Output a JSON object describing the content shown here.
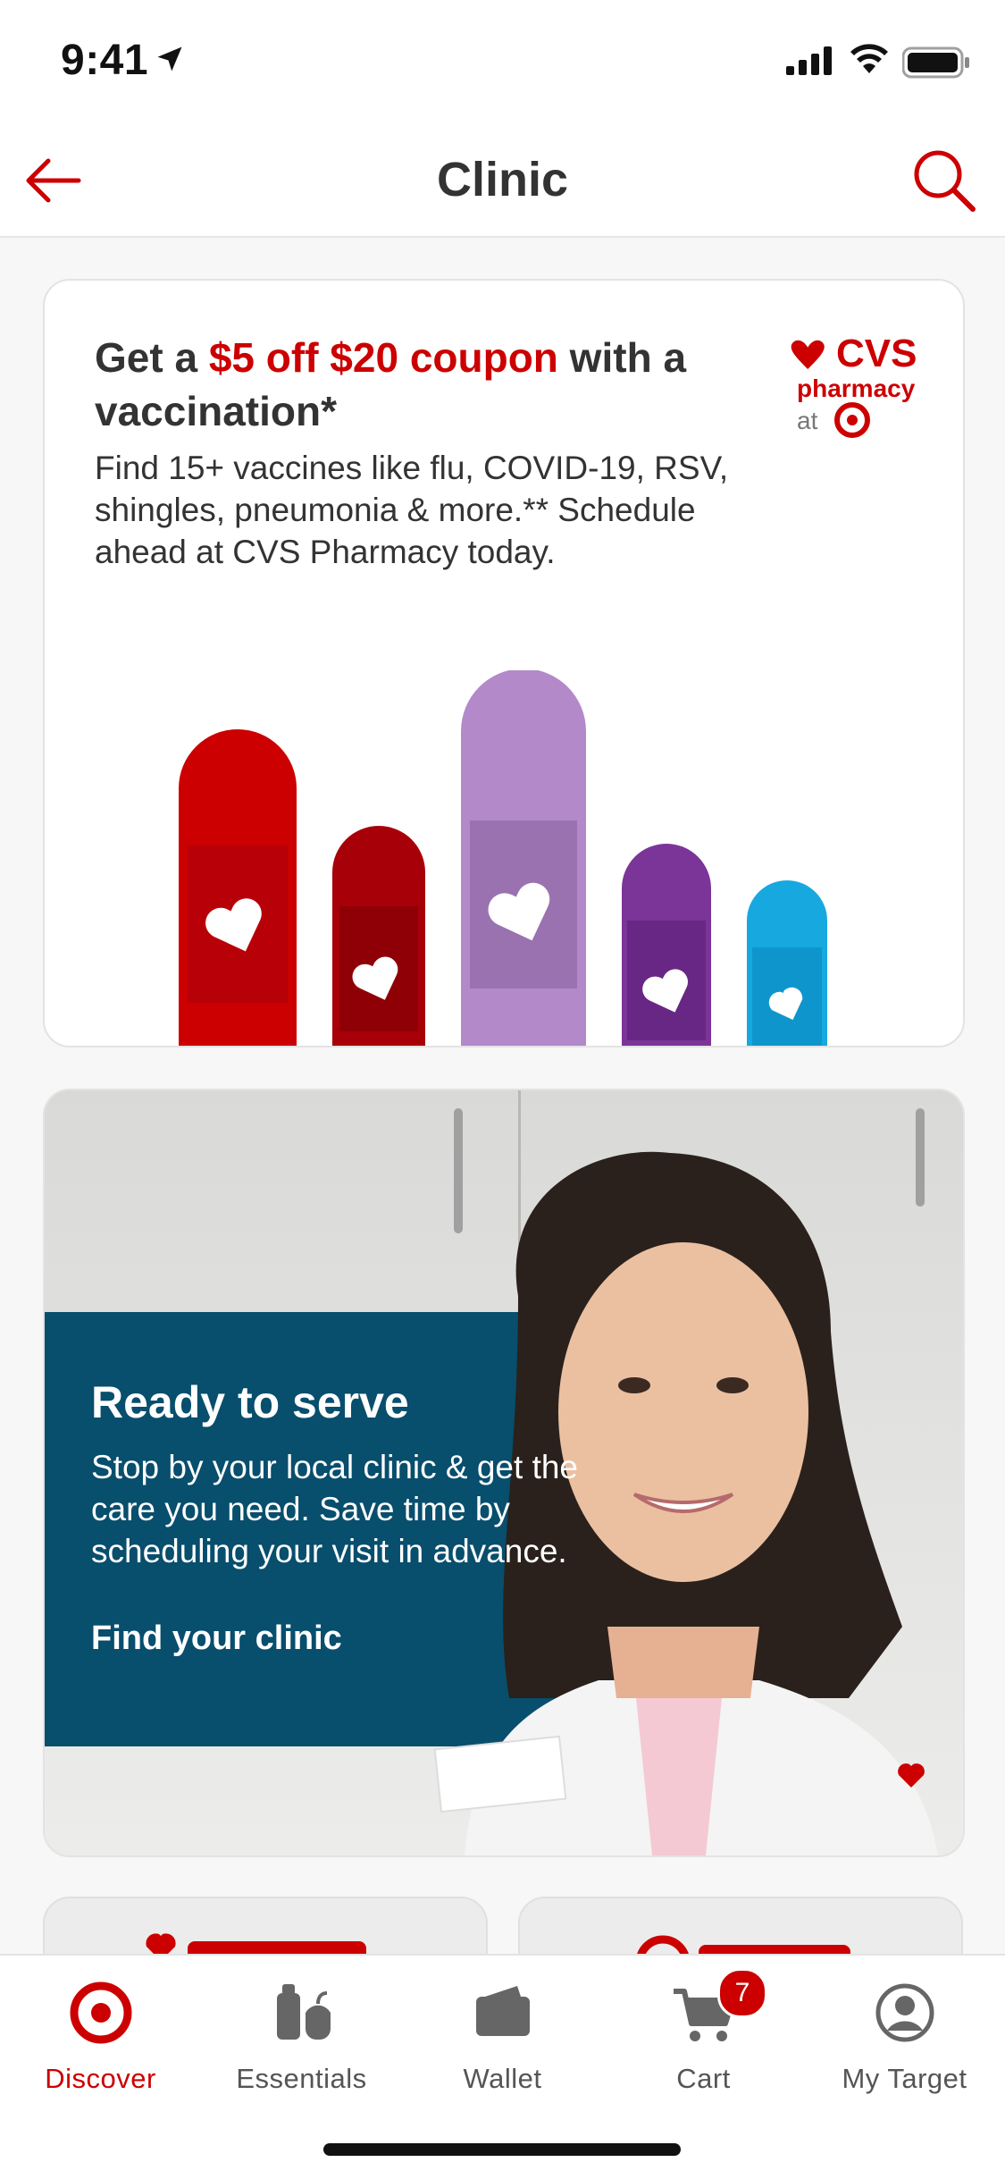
{
  "status_bar": {
    "time": "9:41"
  },
  "nav": {
    "title": "Clinic"
  },
  "promo": {
    "headline_pre": "Get a ",
    "headline_highlight": "$5 off $20 coupon",
    "headline_post": " with a vaccination*",
    "body": "Find 15+ vaccines like flu, COVID-19, RSV, shingles, pneumonia & more.** Schedule ahead at CVS Pharmacy today.",
    "logo": {
      "brand": "CVS",
      "line2": "pharmacy",
      "line3": "at"
    }
  },
  "serve": {
    "title": "Ready to serve",
    "body": "Stop by your local clinic & get the care you need. Save time by scheduling your visit in advance.",
    "link": "Find your clinic"
  },
  "colors": {
    "accent": "#cc0000",
    "panel": "#084e6d"
  },
  "tabs": [
    {
      "label": "Discover",
      "icon": "target-bullseye-icon",
      "active": true
    },
    {
      "label": "Essentials",
      "icon": "essentials-icon"
    },
    {
      "label": "Wallet",
      "icon": "wallet-icon"
    },
    {
      "label": "Cart",
      "icon": "cart-icon",
      "badge": "7"
    },
    {
      "label": "My Target",
      "icon": "account-icon"
    }
  ]
}
